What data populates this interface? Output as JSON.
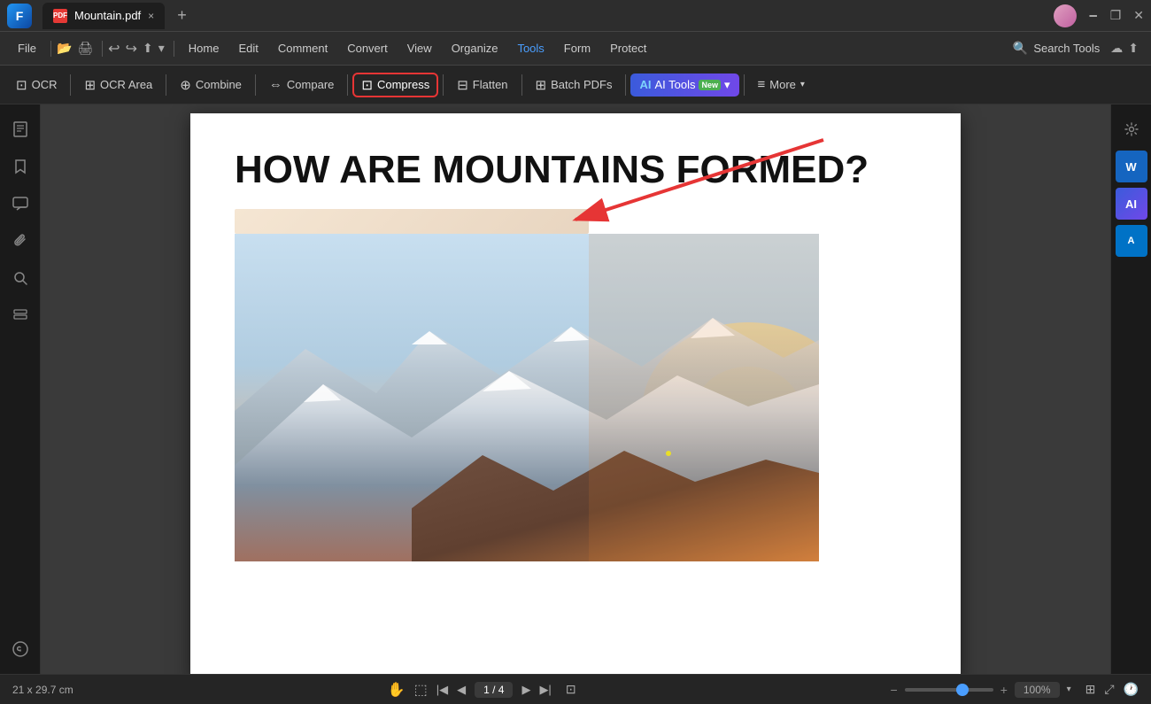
{
  "titlebar": {
    "tab_label": "Mountain.pdf",
    "tab_close": "×",
    "tab_new": "+",
    "avatar_alt": "User avatar"
  },
  "menubar": {
    "file": "File",
    "home": "Home",
    "edit": "Edit",
    "comment": "Comment",
    "convert": "Convert",
    "view": "View",
    "organize": "Organize",
    "tools": "Tools",
    "form": "Form",
    "protect": "Protect",
    "search_tools": "Search Tools"
  },
  "toolbar": {
    "ocr": "OCR",
    "ocr_area": "OCR Area",
    "combine": "Combine",
    "compare": "Compare",
    "compress": "Compress",
    "flatten": "Flatten",
    "batch_pdfs": "Batch PDFs",
    "ai_tools": "AI Tools",
    "ai_tools_new_badge": "New",
    "more": "More"
  },
  "pdf": {
    "title": "HOW ARE MOUNTAINS FORMED?",
    "page_size": "21 x 29.7 cm"
  },
  "bottombar": {
    "page_size": "21 x 29.7 cm",
    "page_indicator": "1 / 4",
    "zoom_level": "100%"
  },
  "sidebar_icons": {
    "page": "☰",
    "bookmark": "🔖",
    "comment": "💬",
    "attachment": "📎",
    "search": "🔍",
    "layers": "❑",
    "help": "?"
  },
  "right_sidebar": {
    "settings": "⚙",
    "word_label": "W",
    "ai_label": "AI",
    "az_label": "A"
  }
}
